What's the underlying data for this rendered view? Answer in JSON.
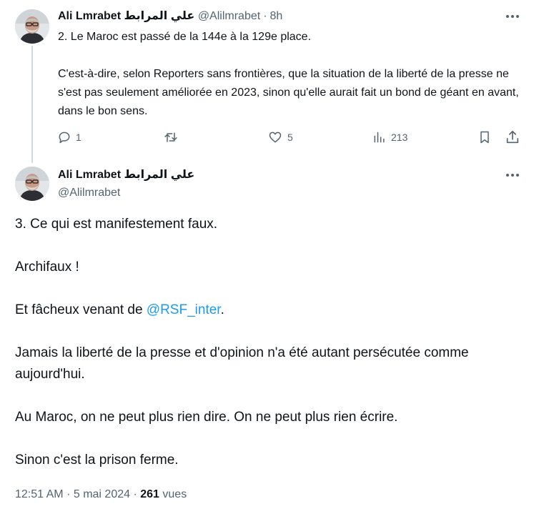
{
  "tweet1": {
    "author_name": "Ali Lmrabet علي المرابط",
    "handle": "@Alilmrabet",
    "separator": "·",
    "time": "8h",
    "paragraphs": [
      "2. Le Maroc est passé de la 144e à la 129e place.",
      "C'est-à-dire, selon Reporters sans frontières, que la situation de la liberté de la presse ne s'est pas seulement améliorée en 2023, sinon qu'elle aurait fait un bond de géant en avant, dans le bon sens."
    ],
    "actions": {
      "replies": "1",
      "reposts": "",
      "likes": "5",
      "views": "213"
    },
    "icons": {
      "reply": "reply-icon",
      "repost": "repost-icon",
      "like": "heart-icon",
      "views": "analytics-icon",
      "bookmark": "bookmark-icon",
      "share": "share-icon",
      "more": "more-icon"
    }
  },
  "tweet2": {
    "author_name": "Ali Lmrabet علي المرابط",
    "handle": "@Alilmrabet",
    "p1": "3. Ce qui est manifestement faux.",
    "p2": "Archifaux !",
    "p3_before": "Et fâcheux venant de ",
    "p3_mention": "@RSF_inter",
    "p3_after": ".",
    "p4": "Jamais la liberté de la presse et d'opinion n'a été autant persécutée comme aujourd'hui.",
    "p5": "Au Maroc, on ne peut plus rien dire. On ne peut plus rien écrire.",
    "p6": "Sinon c'est la prison ferme.",
    "time": "12:51 AM",
    "date": "5 mai 2024",
    "separator": "·",
    "views_count": "261",
    "views_label": "vues"
  },
  "colors": {
    "text": "#0f1419",
    "muted": "#536471",
    "link": "#1d9bf0",
    "thread_line": "#cfd9de"
  }
}
